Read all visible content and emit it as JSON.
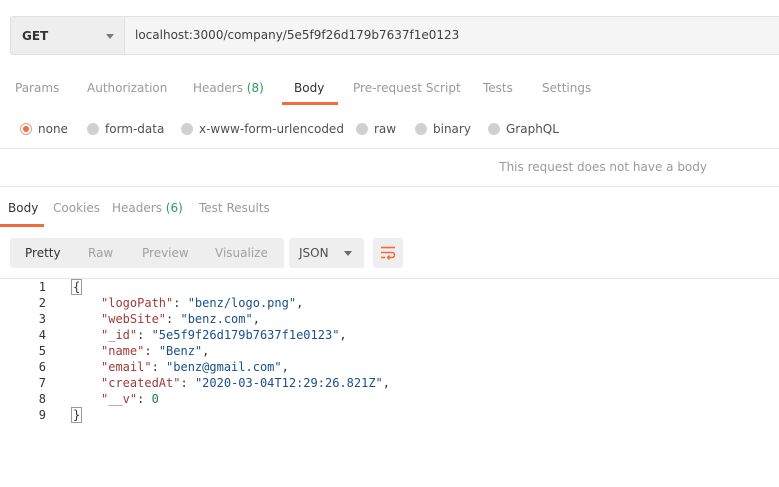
{
  "request": {
    "method": "GET",
    "url": "localhost:3000/company/5e5f9f26d179b7637f1e0123"
  },
  "request_tabs": [
    {
      "label": "Params"
    },
    {
      "label": "Authorization"
    },
    {
      "label": "Headers",
      "count": "(8)"
    },
    {
      "label": "Body",
      "active": true
    },
    {
      "label": "Pre-request Script"
    },
    {
      "label": "Tests"
    },
    {
      "label": "Settings"
    }
  ],
  "body_types": [
    {
      "label": "none",
      "checked": true
    },
    {
      "label": "form-data"
    },
    {
      "label": "x-www-form-urlencoded"
    },
    {
      "label": "raw"
    },
    {
      "label": "binary"
    },
    {
      "label": "GraphQL"
    }
  ],
  "no_body_message": "This request does not have a body",
  "response_tabs": [
    {
      "label": "Body",
      "active": true
    },
    {
      "label": "Cookies"
    },
    {
      "label": "Headers",
      "count": "(6)"
    },
    {
      "label": "Test Results"
    }
  ],
  "view_modes": [
    {
      "label": "Pretty",
      "active": true
    },
    {
      "label": "Raw"
    },
    {
      "label": "Preview"
    },
    {
      "label": "Visualize"
    }
  ],
  "format": "JSON",
  "icons": {
    "method_dropdown": "chevron-down-icon",
    "format_dropdown": "chevron-down-icon",
    "wrap": "wrap-lines-icon"
  },
  "colors": {
    "accent": "#f26b3a",
    "count": "#2e9c5b",
    "json_key": "#a03a3a",
    "json_string": "#1a4f8a",
    "json_number": "#1f7a4a"
  },
  "response_lines": [
    {
      "n": "1",
      "open": "{"
    },
    {
      "n": "2",
      "key": "\"logoPath\"",
      "value": "\"benz/logo.png\"",
      "type": "string",
      "comma": ","
    },
    {
      "n": "3",
      "key": "\"webSite\"",
      "value": "\"benz.com\"",
      "type": "string",
      "comma": ","
    },
    {
      "n": "4",
      "key": "\"_id\"",
      "value": "\"5e5f9f26d179b7637f1e0123\"",
      "type": "string",
      "comma": ","
    },
    {
      "n": "5",
      "key": "\"name\"",
      "value": "\"Benz\"",
      "type": "string",
      "comma": ","
    },
    {
      "n": "6",
      "key": "\"email\"",
      "value": "\"benz@gmail.com\"",
      "type": "string",
      "comma": ","
    },
    {
      "n": "7",
      "key": "\"createdAt\"",
      "value": "\"2020-03-04T12:29:26.821Z\"",
      "type": "string",
      "comma": ","
    },
    {
      "n": "8",
      "key": "\"__v\"",
      "value": "0",
      "type": "number",
      "comma": ""
    },
    {
      "n": "9",
      "close": "}"
    }
  ]
}
